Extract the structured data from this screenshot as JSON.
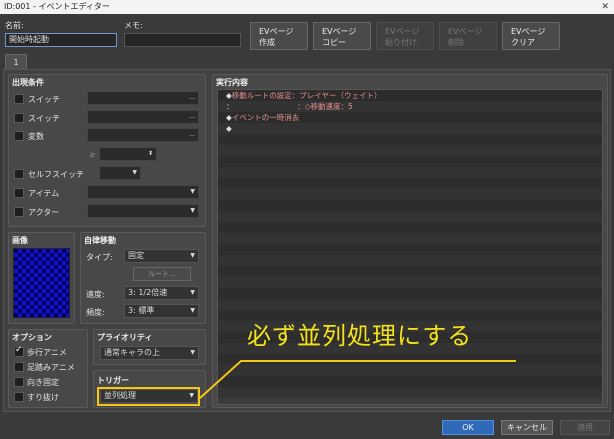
{
  "window": {
    "title": "ID:001 - イベントエディター",
    "close": "✕"
  },
  "header": {
    "name_label": "名前:",
    "name_value": "開始時起動",
    "memo_label": "メモ:",
    "memo_value": ""
  },
  "toolbar": {
    "create": {
      "l1": "EVページ",
      "l2": "作成"
    },
    "copy": {
      "l1": "EVページ",
      "l2": "コピー"
    },
    "paste": {
      "l1": "EVページ",
      "l2": "貼り付け"
    },
    "delete": {
      "l1": "EVページ",
      "l2": "削除"
    },
    "clear": {
      "l1": "EVページ",
      "l2": "クリア"
    }
  },
  "tabs": [
    {
      "label": "1"
    }
  ],
  "conditions": {
    "title": "出現条件",
    "switch1": "スイッチ",
    "switch2": "スイッチ",
    "variable": "変数",
    "ge": "≥",
    "self_switch": "セルフスイッチ",
    "item": "アイテム",
    "actor": "アクター",
    "ellipsis": "..."
  },
  "image": {
    "title": "画像"
  },
  "autonomous": {
    "title": "自律移動",
    "type_label": "タイプ:",
    "type_value": "固定",
    "route_button": "ルート...",
    "speed_label": "速度:",
    "speed_value": "3: 1/2倍速",
    "freq_label": "頻度:",
    "freq_value": "3: 標準"
  },
  "options": {
    "title": "オプション",
    "walking": "歩行アニメ",
    "stepping": "足踏みアニメ",
    "direction_fix": "向き固定",
    "through": "すり抜け"
  },
  "priority": {
    "title": "プライオリティ",
    "value": "通常キャラの上"
  },
  "trigger": {
    "title": "トリガー",
    "value": "並列処理"
  },
  "contents": {
    "title": "実行内容",
    "lines": [
      {
        "bullet": "◆",
        "text": "移動ルートの設定：プレイヤー（ウェイト）"
      },
      {
        "bullet": "：",
        "text": "　　　　　　　　　：◇移動速度：5"
      },
      {
        "bullet": "◆",
        "text": "イベントの一時消去"
      },
      {
        "bullet": "◆",
        "text": ""
      }
    ]
  },
  "annotation": {
    "text": "必ず並列処理にする",
    "color": "#f5e21a"
  },
  "footer": {
    "ok": "OK",
    "cancel": "キャンセル",
    "apply": "適用"
  }
}
